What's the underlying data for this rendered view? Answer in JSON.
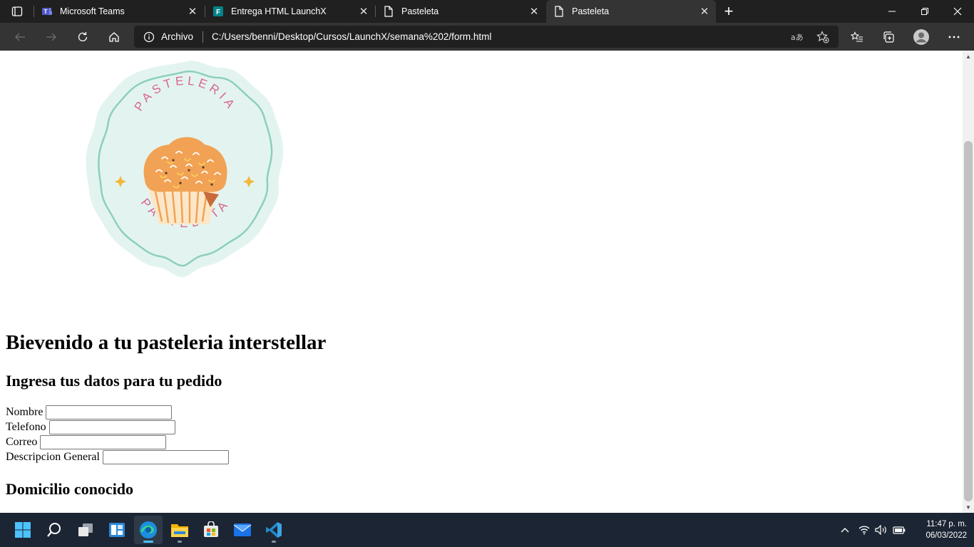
{
  "browser": {
    "tabs": [
      {
        "label": "Microsoft Teams",
        "icon": "teams-icon",
        "active": false
      },
      {
        "label": "Entrega HTML LaunchX",
        "icon": "forms-icon",
        "active": false
      },
      {
        "label": "Pasteleta",
        "icon": "page-icon",
        "active": false
      },
      {
        "label": "Pasteleta",
        "icon": "page-icon",
        "active": true
      }
    ],
    "address": {
      "security_label": "Archivo",
      "url": "C:/Users/benni/Desktop/Cursos/LaunchX/semana%202/form.html"
    }
  },
  "page": {
    "logo": {
      "top_text": "PASTELERIA",
      "bottom_text": "PASTELETA",
      "colors": {
        "badge": "#e3f4f0",
        "ring": "#8ccfbd",
        "text": "#d9668f",
        "sparkle": "#f2b83a",
        "muffin": "#f2a254",
        "cup": "#fbe7c8"
      }
    },
    "heading": "Bievenido a tu pasteleria interstellar",
    "subheading": "Ingresa tus datos para tu pedido",
    "fields": [
      {
        "label": "Nombre",
        "value": ""
      },
      {
        "label": "Telefono",
        "value": ""
      },
      {
        "label": "Correo",
        "value": ""
      },
      {
        "label": "Descripcion General",
        "value": ""
      }
    ],
    "section_heading": "Domicilio conocido"
  },
  "taskbar": {
    "apps": [
      "start-icon",
      "search-icon",
      "task-view-icon",
      "widgets-icon",
      "edge-icon",
      "file-explorer-icon",
      "store-icon",
      "mail-icon",
      "vscode-icon"
    ],
    "time": "11:47 p. m.",
    "date": "06/03/2022"
  }
}
